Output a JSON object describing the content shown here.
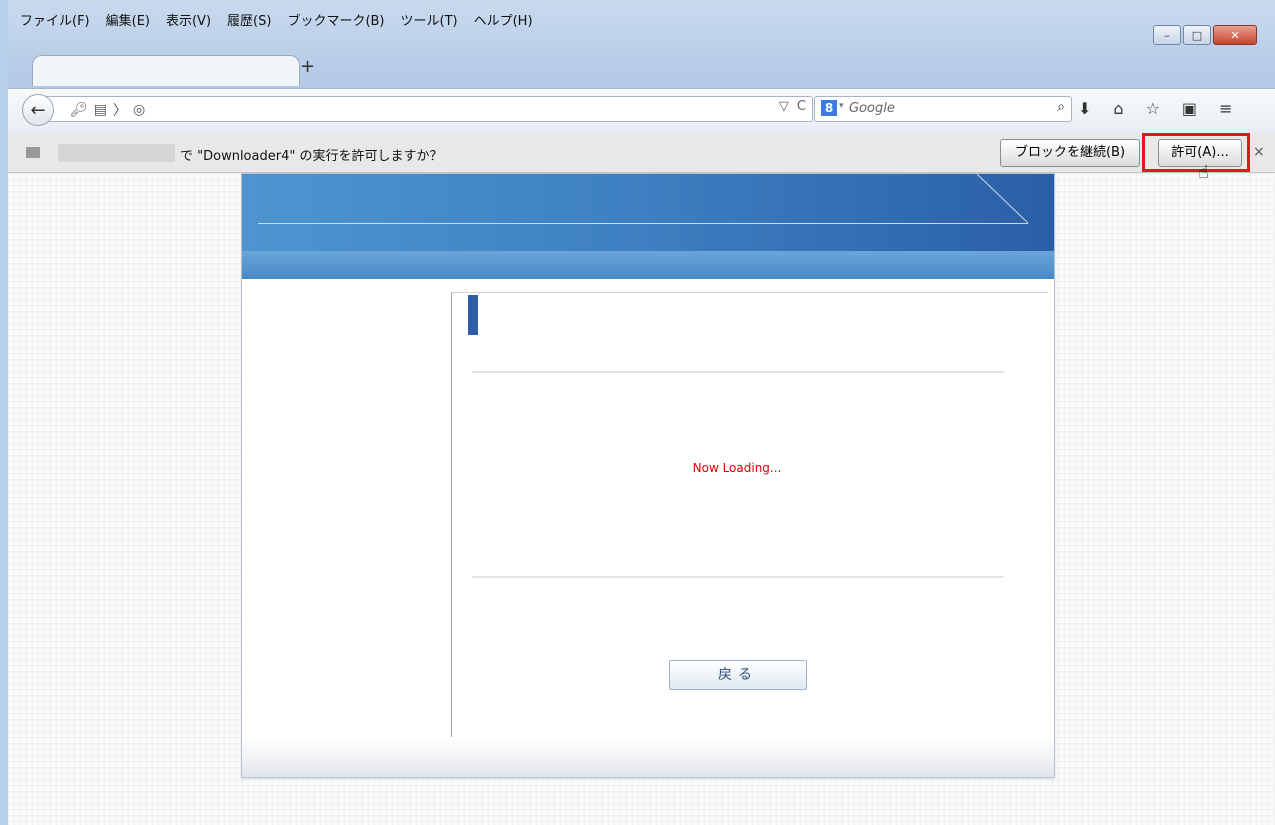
{
  "menu": [
    "ファイル(F)",
    "編集(E)",
    "表示(V)",
    "履歴(S)",
    "ブックマーク(B)",
    "ツール(T)",
    "ヘルプ(H)"
  ],
  "window_controls": {
    "minimize": "–",
    "maximize": "□",
    "close": "✕"
  },
  "tab": {
    "newtab_label": "+"
  },
  "search": {
    "engine_icon": "8",
    "placeholder": "Google"
  },
  "notification": {
    "text": "で \"Downloader4\" の実行を許可しますか？",
    "block_label": "ブロックを継続(B)",
    "allow_label": "許可(A)...",
    "close_label": "×"
  },
  "page": {
    "loading_text": "Now Loading...",
    "back_label": "戻る"
  },
  "colors": {
    "highlight": "#e0181b",
    "loading": "#e00000",
    "banner": "#3d7fc0"
  }
}
